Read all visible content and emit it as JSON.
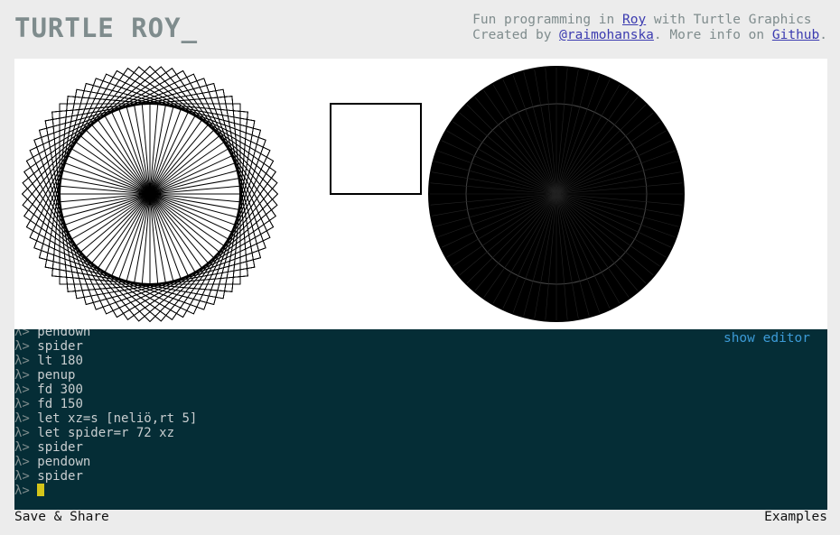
{
  "header": {
    "logo": "TURTLE ROY_",
    "tagline_line1_prefix": "Fun programming in ",
    "tagline_link_roy": "Roy",
    "tagline_line1_suffix": " with Turtle Graphics",
    "tagline_line2_prefix": "Created by ",
    "tagline_link_author": "@raimohanska",
    "tagline_line2_middle": ". More info on ",
    "tagline_link_github": "Github",
    "tagline_line2_suffix": "."
  },
  "console": {
    "show_editor_label": "show editor",
    "prompt_symbol": "λ>",
    "history": [
      "pendown",
      "spider",
      "lt 180",
      "penup",
      "fd 300",
      "fd 150",
      "let xz=s [neliö,rt 5]",
      "let spider=r 72 xz",
      "spider",
      "pendown",
      "spider"
    ],
    "current_input": ""
  },
  "footer": {
    "save_share_label": "Save & Share",
    "examples_label": "Examples"
  },
  "colors": {
    "background": "#ececec",
    "console_bg": "#052d36",
    "cursor": "#d4c51a",
    "link_blue": "#3b3bb0",
    "show_editor": "#3c9ad6"
  }
}
